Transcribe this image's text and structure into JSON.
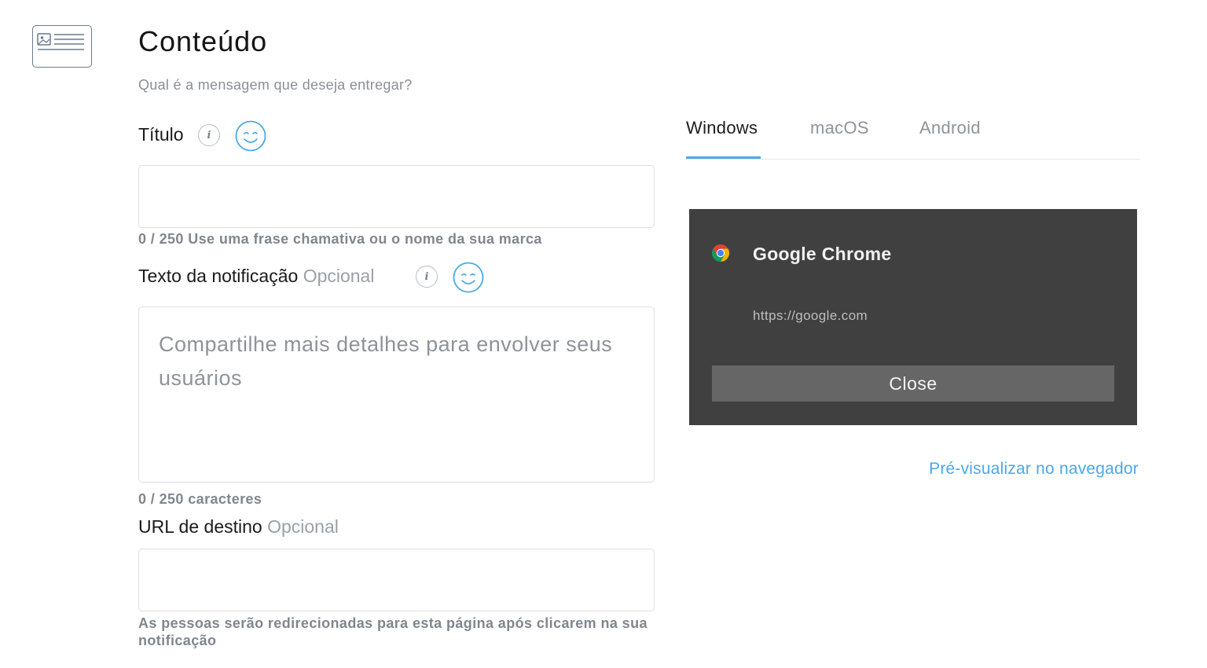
{
  "section": {
    "title": "Conteúdo",
    "subtitle": "Qual é a mensagem que deseja entregar?"
  },
  "fields": {
    "title": {
      "label": "Título",
      "value": "",
      "placeholder": "",
      "hint": "0 / 250 Use uma frase chamativa ou o nome da sua marca"
    },
    "notification_text": {
      "label": "Texto da notificação",
      "optional": "Opcional",
      "value": "",
      "placeholder": "Compartilhe mais detalhes para envolver seus usuários",
      "hint": "0 / 250 caracteres"
    },
    "destination_url": {
      "label": "URL de destino",
      "optional": "Opcional",
      "value": "",
      "placeholder": "",
      "hint": "As pessoas serão redirecionadas para esta página após clicarem na sua notificação"
    }
  },
  "icons": {
    "section": "article-card-icon",
    "info": "info-icon",
    "emoji": "smiley-emoji-icon",
    "browser": "chrome-logo-icon",
    "info_glyph": "i"
  },
  "tabs": [
    {
      "label": "Windows",
      "active": true
    },
    {
      "label": "macOS",
      "active": false
    },
    {
      "label": "Android",
      "active": false
    }
  ],
  "preview": {
    "app_name": "Google Chrome",
    "url": "https://google.com",
    "close_label": "Close",
    "link_label": "Pré-visualizar no navegador"
  },
  "colors": {
    "accent": "#4aa9e8",
    "preview_bg": "#404040",
    "preview_button": "#666666"
  }
}
